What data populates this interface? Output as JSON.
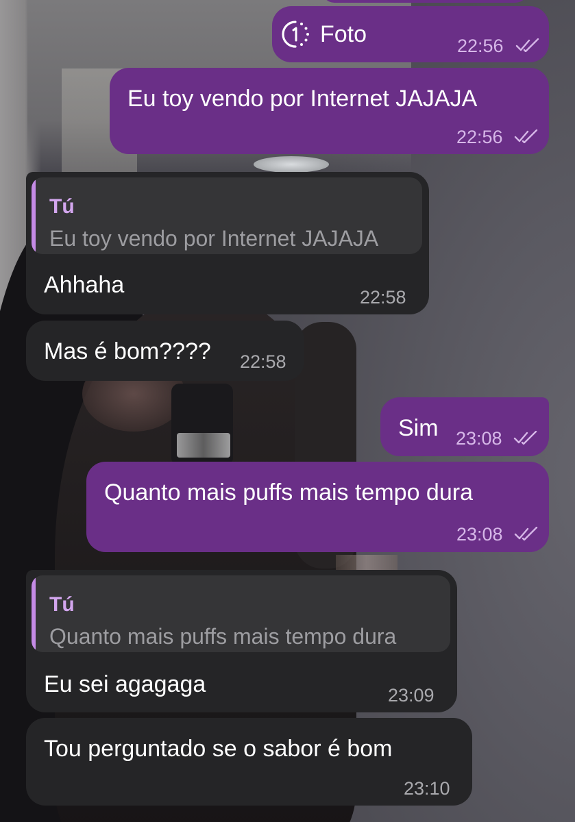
{
  "messages": [
    {
      "direction": "outgoing",
      "type": "view_once_photo",
      "icon": "view-once-timer-icon",
      "text": "Foto",
      "time": "22:56",
      "status": "read"
    },
    {
      "direction": "outgoing",
      "text": "Eu toy vendo por Internet JAJAJA",
      "time": "22:56",
      "status": "read"
    },
    {
      "direction": "incoming",
      "reply_to": {
        "author": "Tú",
        "text": "Eu toy vendo por Internet JAJAJA"
      },
      "text": "Ahhaha",
      "time": "22:58"
    },
    {
      "direction": "incoming",
      "text": "Mas é bom????",
      "time": "22:58"
    },
    {
      "direction": "outgoing",
      "text": "Sim",
      "time": "23:08",
      "status": "read"
    },
    {
      "direction": "outgoing",
      "text": "Quanto mais puffs mais tempo dura",
      "time": "23:08",
      "status": "read"
    },
    {
      "direction": "incoming",
      "reply_to": {
        "author": "Tú",
        "text": "Quanto mais puffs mais tempo dura"
      },
      "text": "Eu sei agagaga",
      "time": "23:09"
    },
    {
      "direction": "incoming",
      "text": "Tou perguntado se o sabor é bom",
      "time": "23:10"
    }
  ],
  "colors": {
    "outgoing_bubble": "#6a2f87",
    "incoming_bubble": "#252527",
    "quote_background": "#353537",
    "quote_accent": "#c58be6",
    "quote_author": "#d3a6ee"
  }
}
